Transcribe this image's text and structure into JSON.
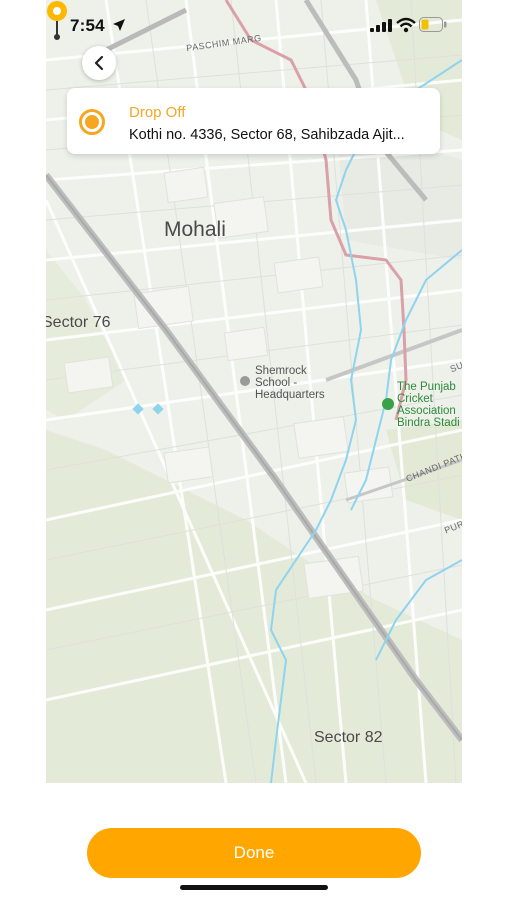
{
  "status_bar": {
    "time": "7:54",
    "icons": [
      "location-arrow-icon",
      "cellular-signal-icon",
      "wifi-icon",
      "battery-low-icon"
    ]
  },
  "back_button": {
    "icon": "chevron-left-icon"
  },
  "drop_card": {
    "label": "Drop Off",
    "address": "Kothi no. 4336, Sector 68, Sahibzada Ajit...",
    "icon": "radio-selected-icon",
    "accent_color": "#F5A623"
  },
  "map": {
    "labels": {
      "paschim_marg": "PASCHIM MARG",
      "mohali": "Mohali",
      "sector_76": "Sector 76",
      "sector_82": "Sector 82",
      "shemrock_line1": "Shemrock",
      "shemrock_line2": "School -",
      "shemrock_line3": "Headquarters",
      "punjab_line1": "The Punjab",
      "punjab_line2": "Cricket",
      "punjab_line3": "Association",
      "punjab_line4": "Bindra Stadi",
      "chandi_path": "CHANDI PATH",
      "pur": "PUR",
      "su": "SU"
    },
    "pin_icon": "map-pin-icon",
    "pin_color": "#FFB800"
  },
  "done_button": {
    "label": "Done",
    "color": "#FFA600"
  }
}
